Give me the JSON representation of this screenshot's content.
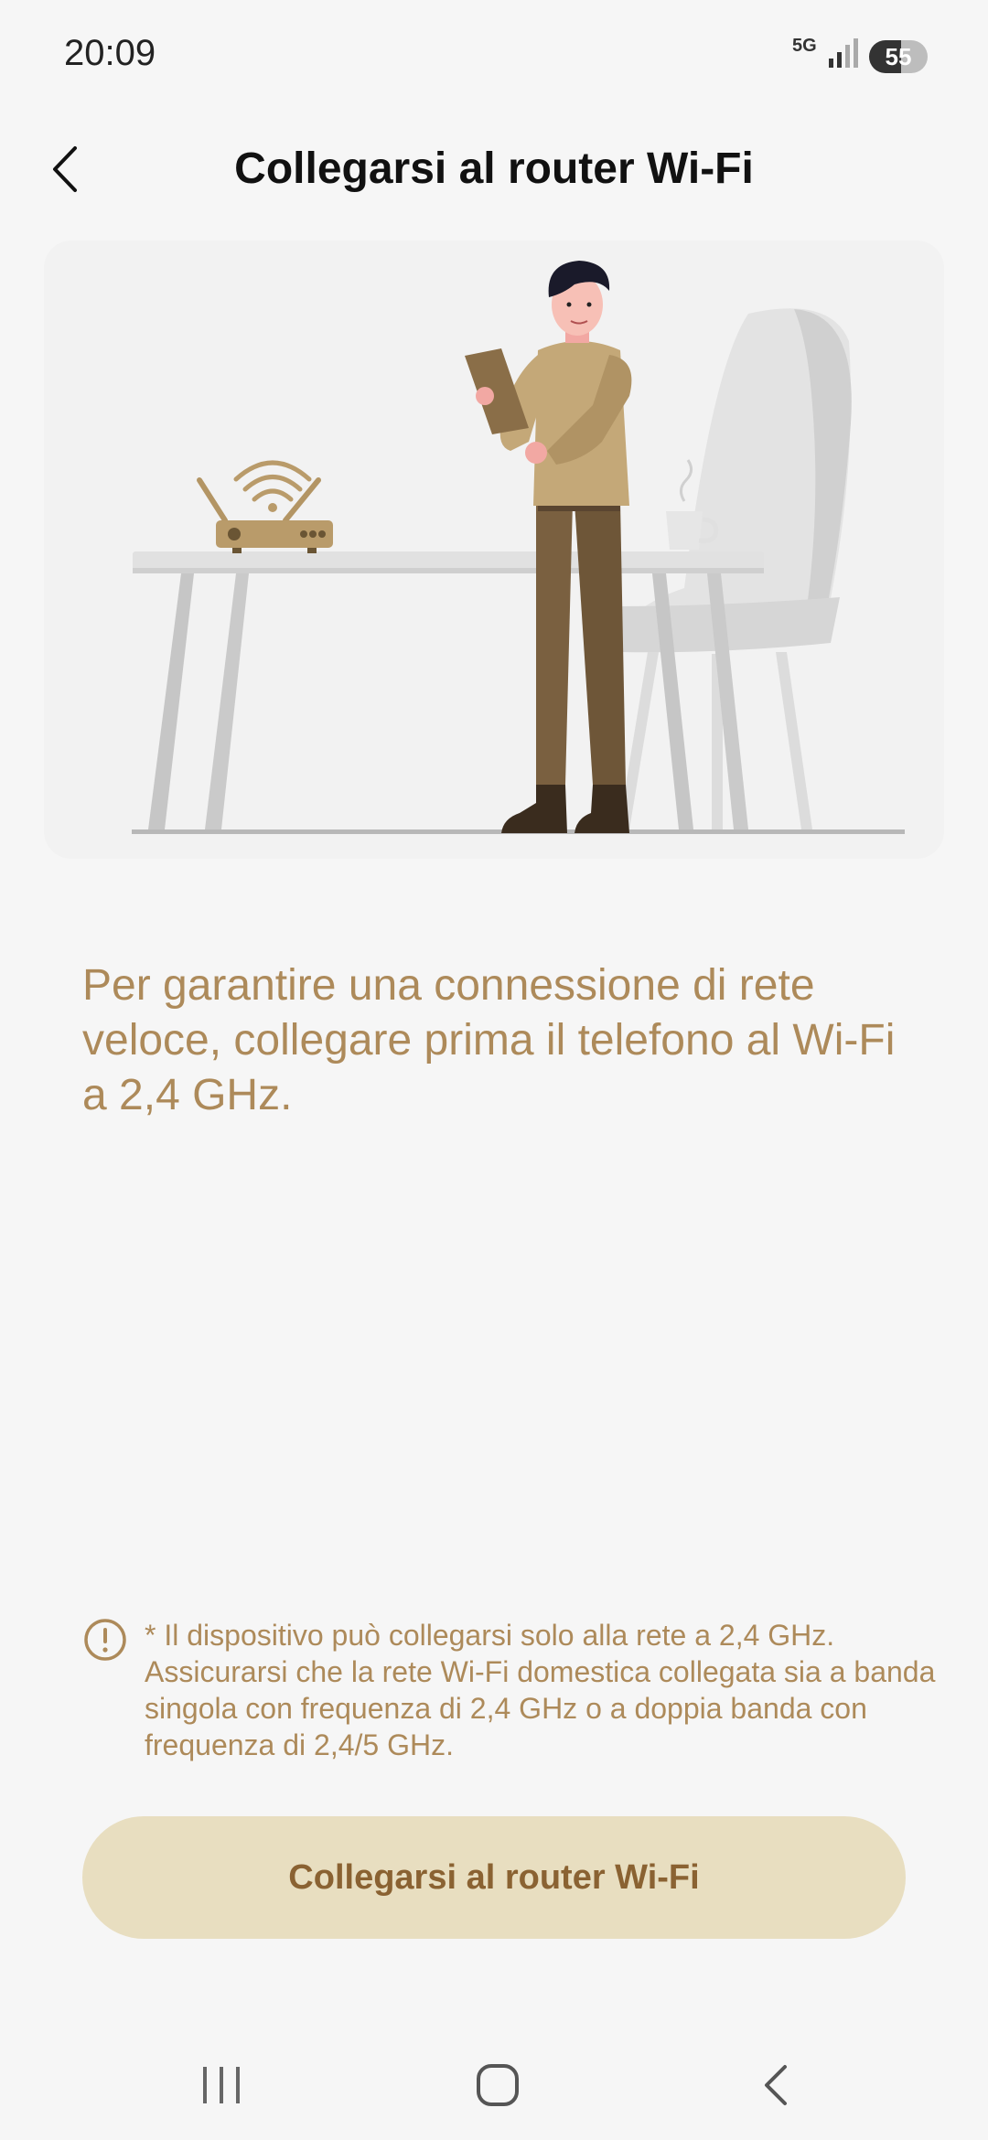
{
  "status_bar": {
    "time": "20:09",
    "network": "5G",
    "battery": "55",
    "battery_level": 0.55
  },
  "header": {
    "back_icon": "chevron-left-icon",
    "title": "Collegarsi al router Wi-Fi"
  },
  "illustration": {
    "name": "man-with-tablet-and-router-illustration"
  },
  "main": {
    "description": "Per garantire una connessione di rete veloce, collegare prima il telefono al Wi-Fi a 2,4 GHz."
  },
  "notice": {
    "icon": "exclamation-circle-icon",
    "text": "* Il dispositivo può collegarsi solo alla rete a 2,4 GHz. Assicurarsi che la rete Wi-Fi domestica collegata sia a banda singola con frequenza di 2,4 GHz o a doppia banda con frequenza di 2,4/5 GHz."
  },
  "actions": {
    "connect_label": "Collegarsi al router Wi-Fi"
  },
  "navigation": {
    "recent_icon": "recent-apps-icon",
    "home_icon": "home-icon",
    "back_icon": "back-icon"
  },
  "colors": {
    "accent": "#ad8a5a",
    "button_bg": "#e8dec0",
    "button_text": "#8a6232",
    "background": "#f6f6f6"
  }
}
